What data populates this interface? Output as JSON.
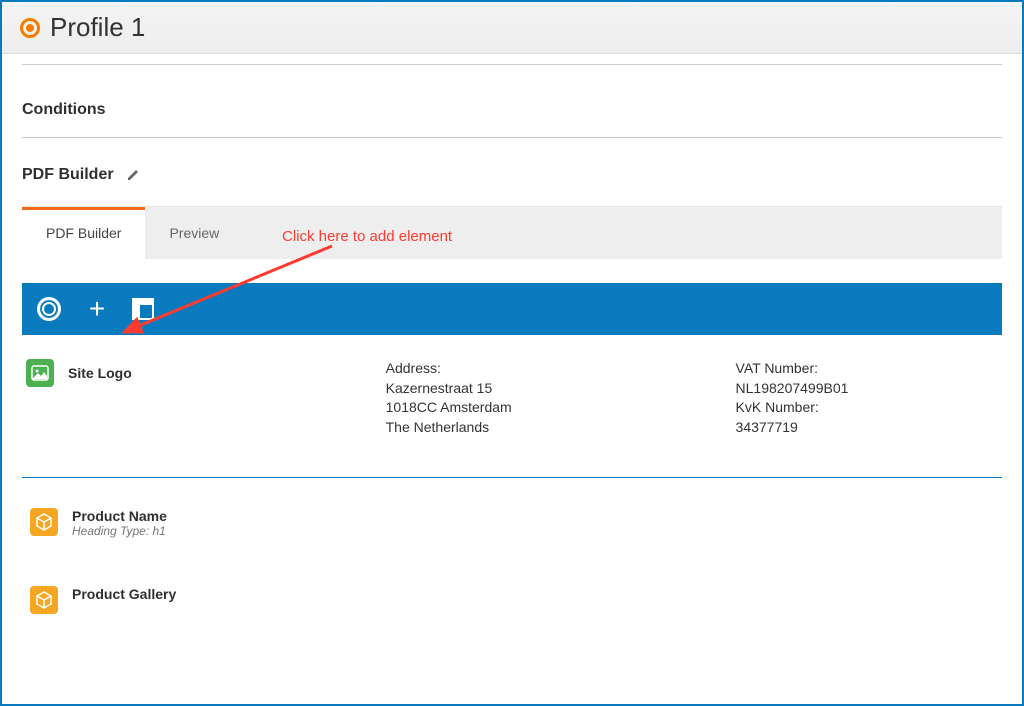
{
  "header": {
    "title": "Profile 1"
  },
  "sections": {
    "conditions": "Conditions",
    "pdfbuilder": "PDF Builder"
  },
  "tabs": {
    "builder": "PDF Builder",
    "preview": "Preview"
  },
  "annotation": {
    "text": "Click here to add element"
  },
  "row1": {
    "logo_label": "Site Logo",
    "address": {
      "label": "Address:",
      "line1": "Kazernestraat 15",
      "line2": "1018CC Amsterdam",
      "line3": "The Netherlands"
    },
    "vat": {
      "vat_label": "VAT Number:",
      "vat_value": "NL198207499B01",
      "kvk_label": "KvK Number:",
      "kvk_value": "34377719"
    }
  },
  "row2": {
    "title": "Product Name",
    "subtitle": "Heading Type: h1"
  },
  "row3": {
    "title": "Product Gallery"
  }
}
